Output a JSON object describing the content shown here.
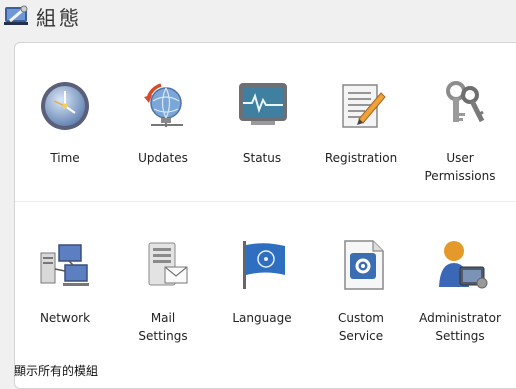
{
  "page": {
    "title": "組態"
  },
  "modules_row1": [
    {
      "label": "Time",
      "icon": "clock-icon"
    },
    {
      "label": "Updates",
      "icon": "globe-update-icon"
    },
    {
      "label": "Status",
      "icon": "monitor-status-icon"
    },
    {
      "label": "Registration",
      "icon": "registration-icon"
    },
    {
      "label": "User\nPermissions",
      "icon": "keys-icon"
    }
  ],
  "modules_row2": [
    {
      "label": "Network",
      "icon": "network-icon"
    },
    {
      "label": "Mail\nSettings",
      "icon": "mail-server-icon"
    },
    {
      "label": "Language",
      "icon": "flag-icon"
    },
    {
      "label": "Custom\nService",
      "icon": "custom-service-icon"
    },
    {
      "label": "Administrator\nSettings",
      "icon": "administrator-icon"
    }
  ],
  "footer": {
    "show_all_label": "顯示所有的模組"
  }
}
